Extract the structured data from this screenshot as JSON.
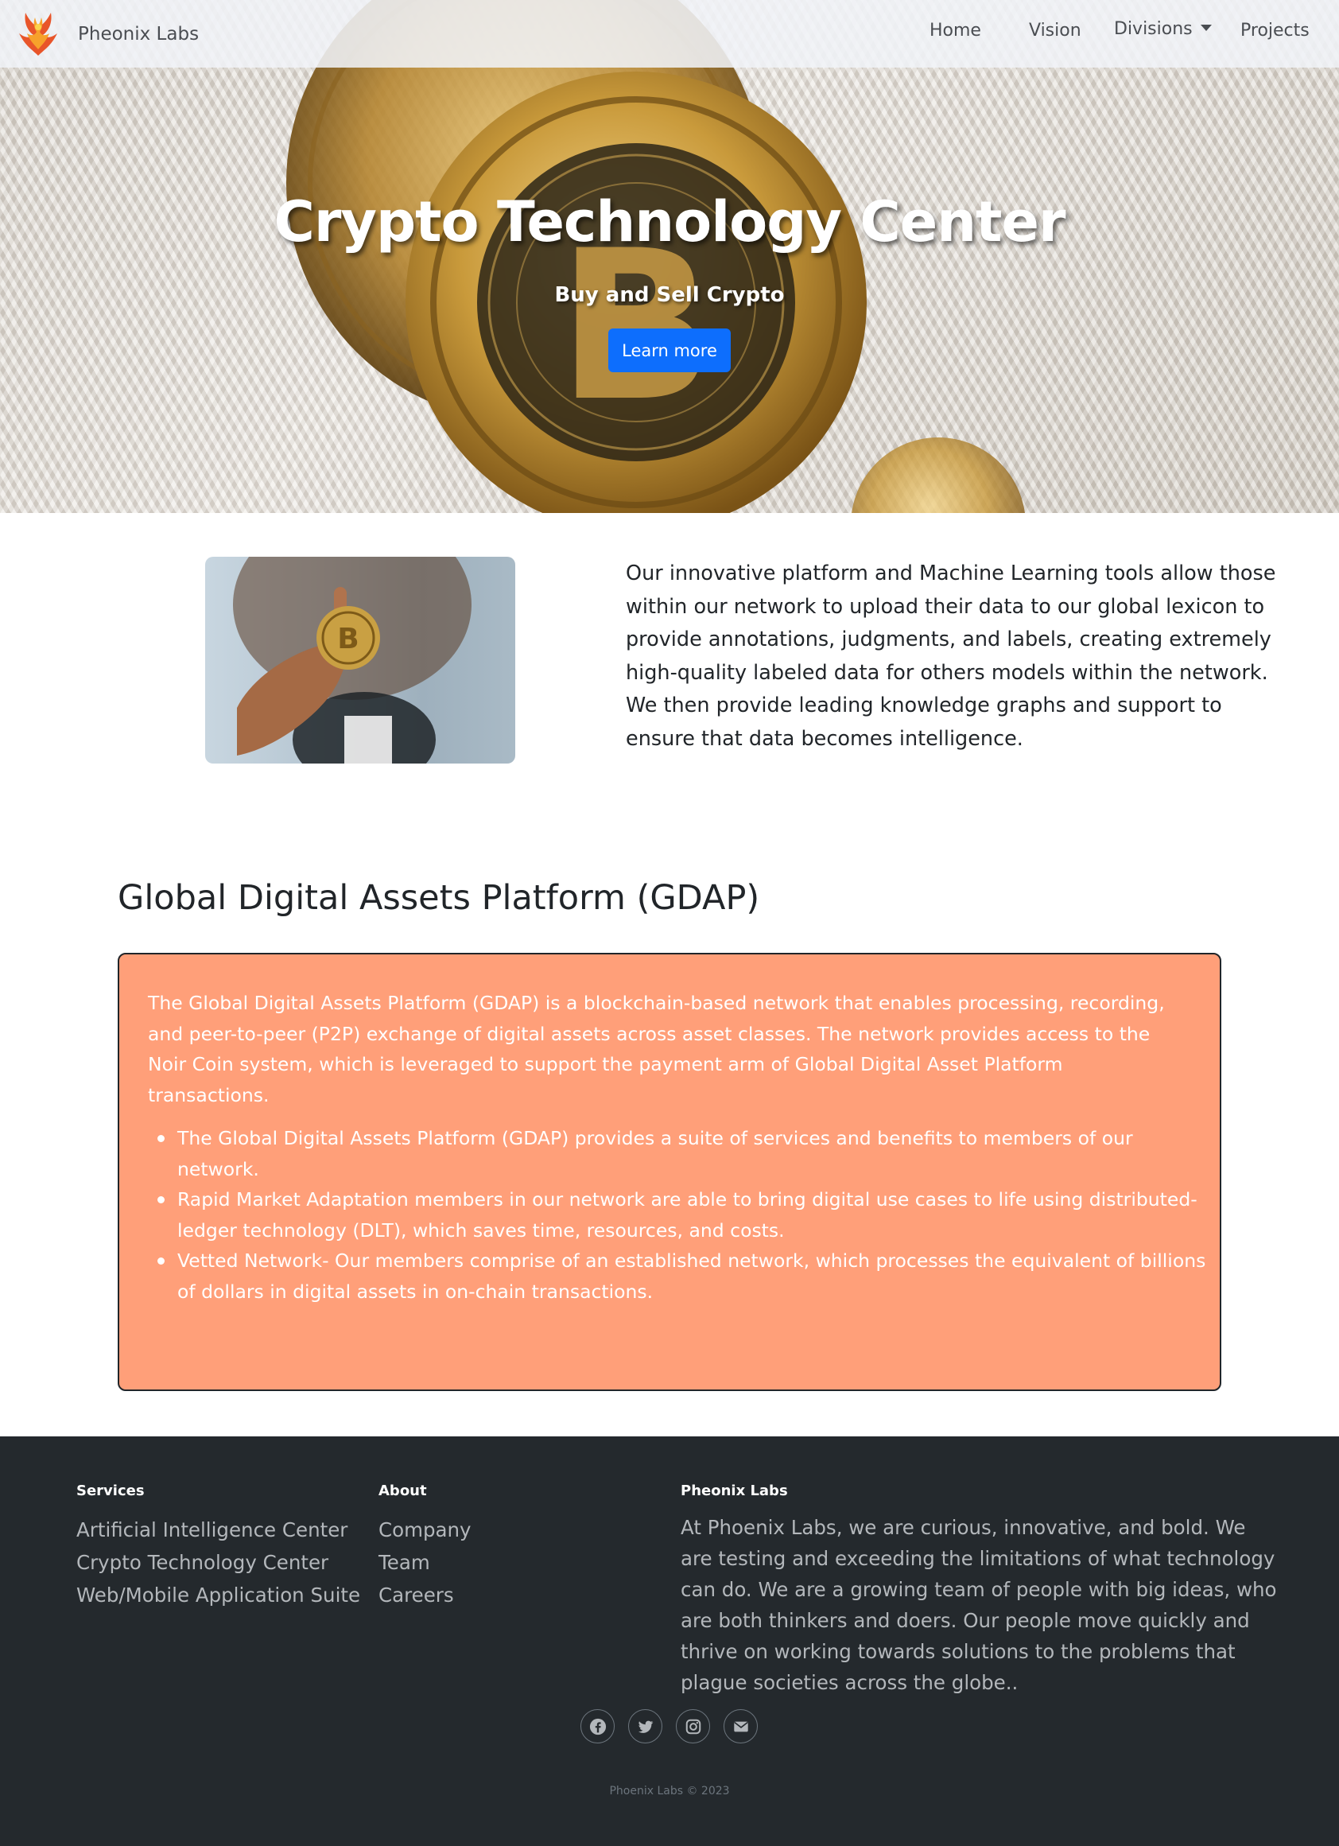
{
  "colors": {
    "primary": "#0d6efd",
    "gdap_bg": "#ff9f79",
    "footer_bg": "#24292d",
    "footer_text": "#b3b7bb"
  },
  "navbar": {
    "brand_icon": "phoenix-logo-icon",
    "brand_name": "Pheonix Labs",
    "links": {
      "home": "Home",
      "vision": "Vision",
      "divisions": "Divisions",
      "projects": "Projects"
    },
    "divisions_icon": "caret-down-icon"
  },
  "hero": {
    "title": "Crypto Technology Center",
    "subtitle": "Buy and Sell Crypto",
    "button": "Learn more"
  },
  "intro": {
    "text": "Our innovative platform and Machine Learning tools allow those within our network to upload their data to our global lexicon to provide annotations, judgments, and labels, creating extremely high-quality labeled data for others models within the network. We then provide leading knowledge graphs and support to ensure that data becomes intelligence."
  },
  "gdap": {
    "title": "Global Digital Assets Platform (GDAP)",
    "paragraph": "The Global Digital Assets Platform (GDAP) is a blockchain-based network that enables processing, recording, and peer-to-peer (P2P) exchange of digital assets across asset classes. The network provides access to the Noir Coin system, which is leveraged to support the payment arm of Global Digital Asset Platform transactions.",
    "bullets": [
      "The Global Digital Assets Platform (GDAP) provides a suite of services and benefits to members of our network.",
      "Rapid Market Adaptation members in our network are able to bring digital use cases to life using distributed-ledger technology (DLT), which saves time, resources, and costs.",
      "Vetted Network- Our members comprise of an established network, which processes the equivalent of billions of dollars in digital assets in on-chain transactions."
    ]
  },
  "footer": {
    "services": {
      "heading": "Services",
      "items": [
        "Artificial Intelligence Center",
        "Crypto Technology Center",
        "Web/Mobile Application Suite"
      ]
    },
    "about": {
      "heading": "About",
      "items": [
        "Company",
        "Team",
        "Careers"
      ]
    },
    "company": {
      "heading": "Pheonix Labs",
      "text": "At Phoenix Labs, we are curious, innovative, and bold. We are testing and exceeding the limitations of what technology can do. We are a growing team of people with big ideas, who are both thinkers and doers. Our people move quickly and thrive on working towards solutions to the problems that plague societies across the globe.."
    },
    "social_icons": [
      "facebook-icon",
      "twitter-icon",
      "instagram-icon",
      "envelope-icon"
    ],
    "copyright": "Phoenix Labs © 2023"
  }
}
